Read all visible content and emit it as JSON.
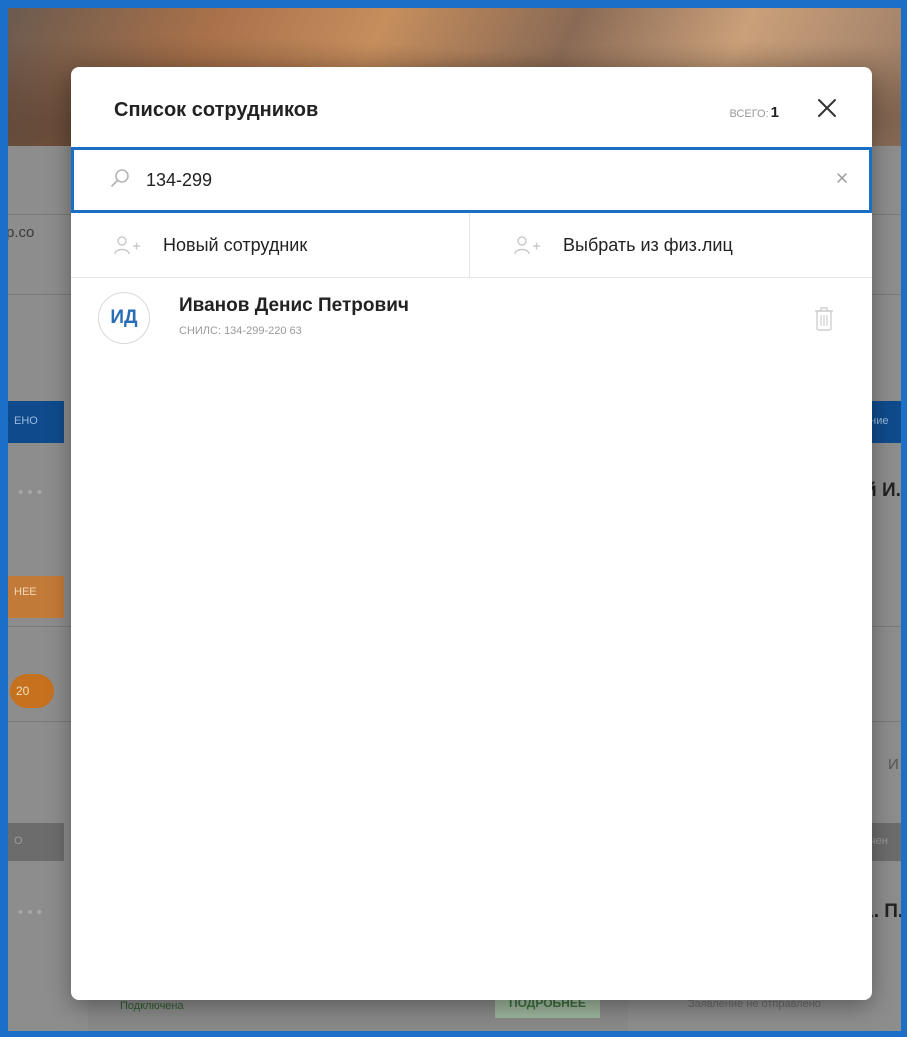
{
  "background": {
    "fragments": {
      "email": "p.co",
      "tab_left_1": "ЕНО",
      "tab_right_1": "ение",
      "dots_1": "• • •",
      "name_right_1": "й И.",
      "more_left": "НЕЕ",
      "badge": "20",
      "tab_left_2": "О",
      "tab_right_2": "очен",
      "dots_2": "• • •",
      "name_right_2": "А. П.",
      "bottom_status": "Подключена",
      "bottom_more": "ПОДРОБНЕЕ",
      "bottom_right": "Заявление не отправлено",
      "edit_fragment": "И"
    }
  },
  "modal": {
    "title": "Список сотрудников",
    "total_label": "всего:",
    "total_count": "1"
  },
  "search": {
    "value": "134-299",
    "placeholder": ""
  },
  "actions": {
    "new_employee": "Новый сотрудник",
    "choose_from_persons": "Выбрать из физ.лиц"
  },
  "employees": [
    {
      "initials": "ИД",
      "name": "Иванов Денис Петрович",
      "snils": "СНИЛС: 134-299-220 63"
    }
  ],
  "icons": {
    "search": "search-icon",
    "close": "close-icon",
    "clear": "clear-icon",
    "add_user": "add-user-icon",
    "trash": "trash-icon"
  },
  "colors": {
    "accent": "#1a6fc6",
    "avatar_text": "#2a6cb5"
  }
}
